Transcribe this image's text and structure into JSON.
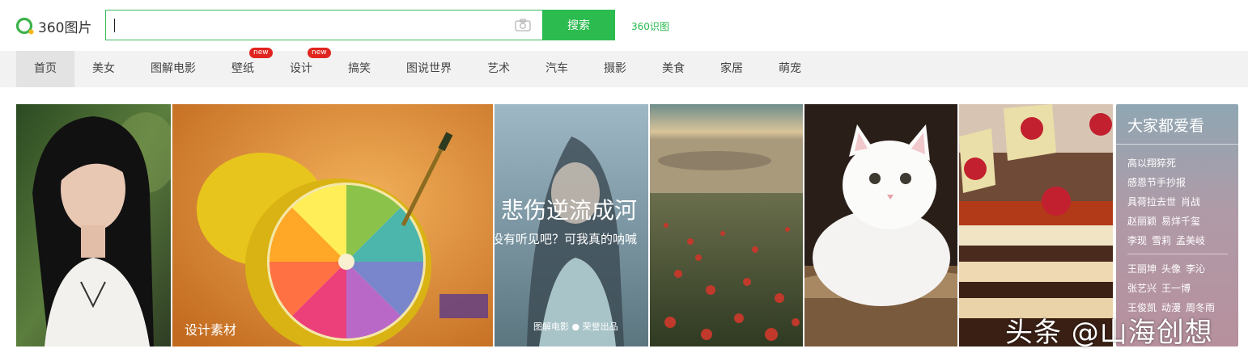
{
  "header": {
    "logo_text": "360图片",
    "search_value": "",
    "search_button": "搜索",
    "shitu_link": "360识图"
  },
  "nav": {
    "items": [
      {
        "label": "首页",
        "active": true
      },
      {
        "label": "美女"
      },
      {
        "label": "图解电影"
      },
      {
        "label": "壁纸",
        "badge": "new"
      },
      {
        "label": "设计",
        "badge": "new"
      },
      {
        "label": "搞笑"
      },
      {
        "label": "图说世界"
      },
      {
        "label": "艺术"
      },
      {
        "label": "汽车"
      },
      {
        "label": "摄影"
      },
      {
        "label": "美食"
      },
      {
        "label": "家居"
      },
      {
        "label": "萌宠"
      }
    ]
  },
  "gallery": {
    "design_caption": "设计素材",
    "movie_title": "悲伤逆流成河",
    "movie_subtitle": "没有听见吧？可我真的呐喊",
    "movie_footer": "图解电影 ● 荣誉出品"
  },
  "sidebar": {
    "title": "大家都爱看",
    "rows": [
      [
        "高以翔猝死"
      ],
      [
        "感恩节手抄报"
      ],
      [
        "具荷拉去世",
        "肖战"
      ],
      [
        "赵丽颖",
        "易烊千玺"
      ],
      [
        "李现",
        "雪莉",
        "孟美岐"
      ],
      [
        "王丽坤",
        "头像",
        "李沁"
      ],
      [
        "张艺兴",
        "王一博"
      ],
      [
        "王俊凯",
        "动漫",
        "周冬雨"
      ]
    ]
  },
  "watermark": "头条 @山海创想",
  "colors": {
    "brand_green": "#2bbb4f",
    "badge_red": "#e0241f",
    "nav_bg": "#f2f2f2"
  },
  "icons": {
    "logo": "360-logo-icon",
    "camera": "camera-icon"
  }
}
